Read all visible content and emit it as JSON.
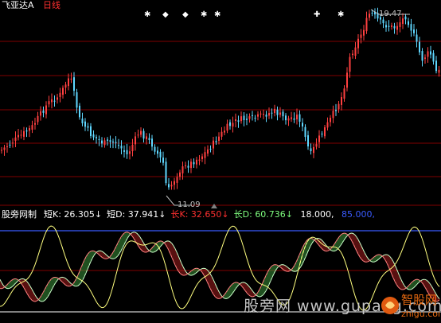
{
  "header": {
    "symbol": "飞亚达A",
    "period": "日线",
    "high_label": "19.47",
    "low_label": "11.09"
  },
  "indicator": {
    "name": "股旁网制",
    "values": [
      {
        "label": "短K:",
        "value": "26.305",
        "arrow": "↓",
        "color": "#ffffff"
      },
      {
        "label": "短D:",
        "value": "37.941",
        "arrow": "↓",
        "color": "#ffffff"
      },
      {
        "label": "长K:",
        "value": "32.650",
        "arrow": "↓",
        "color": "#ff3030"
      },
      {
        "label": "长D:",
        "value": "60.736",
        "arrow": "↓",
        "color": "#7fff7f"
      },
      {
        "label": "",
        "value": "18.000,",
        "arrow": "",
        "color": "#ffffff"
      },
      {
        "label": "",
        "value": "85.000,",
        "arrow": "",
        "color": "#3a5bff"
      }
    ]
  },
  "watermark": {
    "text": "股旁网 www.gupang.com",
    "logo_text": "智股网",
    "logo_sub": "zhigu.com"
  },
  "colors": {
    "up": "#ff4040",
    "down": "#5fd7ff",
    "grid": "#800000",
    "long_band_up": "#b02020",
    "long_band_down": "#3fa03f",
    "short_line": "#ffff80",
    "white_line": "#ffffff"
  }
}
